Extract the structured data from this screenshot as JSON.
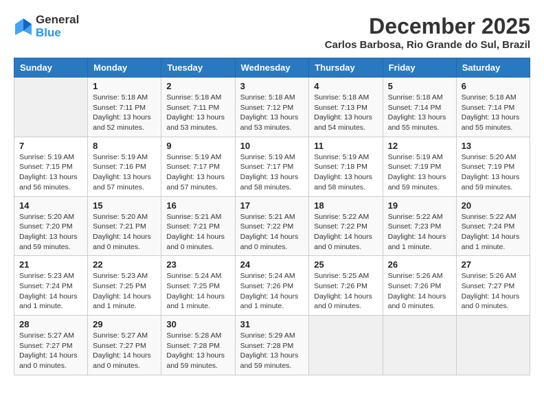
{
  "header": {
    "logo_line1": "General",
    "logo_line2": "Blue",
    "month_year": "December 2025",
    "location": "Carlos Barbosa, Rio Grande do Sul, Brazil"
  },
  "weekdays": [
    "Sunday",
    "Monday",
    "Tuesday",
    "Wednesday",
    "Thursday",
    "Friday",
    "Saturday"
  ],
  "weeks": [
    [
      {
        "day": "",
        "info": ""
      },
      {
        "day": "1",
        "info": "Sunrise: 5:18 AM\nSunset: 7:11 PM\nDaylight: 13 hours\nand 52 minutes."
      },
      {
        "day": "2",
        "info": "Sunrise: 5:18 AM\nSunset: 7:11 PM\nDaylight: 13 hours\nand 53 minutes."
      },
      {
        "day": "3",
        "info": "Sunrise: 5:18 AM\nSunset: 7:12 PM\nDaylight: 13 hours\nand 53 minutes."
      },
      {
        "day": "4",
        "info": "Sunrise: 5:18 AM\nSunset: 7:13 PM\nDaylight: 13 hours\nand 54 minutes."
      },
      {
        "day": "5",
        "info": "Sunrise: 5:18 AM\nSunset: 7:14 PM\nDaylight: 13 hours\nand 55 minutes."
      },
      {
        "day": "6",
        "info": "Sunrise: 5:18 AM\nSunset: 7:14 PM\nDaylight: 13 hours\nand 55 minutes."
      }
    ],
    [
      {
        "day": "7",
        "info": "Sunrise: 5:19 AM\nSunset: 7:15 PM\nDaylight: 13 hours\nand 56 minutes."
      },
      {
        "day": "8",
        "info": "Sunrise: 5:19 AM\nSunset: 7:16 PM\nDaylight: 13 hours\nand 57 minutes."
      },
      {
        "day": "9",
        "info": "Sunrise: 5:19 AM\nSunset: 7:17 PM\nDaylight: 13 hours\nand 57 minutes."
      },
      {
        "day": "10",
        "info": "Sunrise: 5:19 AM\nSunset: 7:17 PM\nDaylight: 13 hours\nand 58 minutes."
      },
      {
        "day": "11",
        "info": "Sunrise: 5:19 AM\nSunset: 7:18 PM\nDaylight: 13 hours\nand 58 minutes."
      },
      {
        "day": "12",
        "info": "Sunrise: 5:19 AM\nSunset: 7:19 PM\nDaylight: 13 hours\nand 59 minutes."
      },
      {
        "day": "13",
        "info": "Sunrise: 5:20 AM\nSunset: 7:19 PM\nDaylight: 13 hours\nand 59 minutes."
      }
    ],
    [
      {
        "day": "14",
        "info": "Sunrise: 5:20 AM\nSunset: 7:20 PM\nDaylight: 13 hours\nand 59 minutes."
      },
      {
        "day": "15",
        "info": "Sunrise: 5:20 AM\nSunset: 7:21 PM\nDaylight: 14 hours\nand 0 minutes."
      },
      {
        "day": "16",
        "info": "Sunrise: 5:21 AM\nSunset: 7:21 PM\nDaylight: 14 hours\nand 0 minutes."
      },
      {
        "day": "17",
        "info": "Sunrise: 5:21 AM\nSunset: 7:22 PM\nDaylight: 14 hours\nand 0 minutes."
      },
      {
        "day": "18",
        "info": "Sunrise: 5:22 AM\nSunset: 7:22 PM\nDaylight: 14 hours\nand 0 minutes."
      },
      {
        "day": "19",
        "info": "Sunrise: 5:22 AM\nSunset: 7:23 PM\nDaylight: 14 hours\nand 1 minute."
      },
      {
        "day": "20",
        "info": "Sunrise: 5:22 AM\nSunset: 7:24 PM\nDaylight: 14 hours\nand 1 minute."
      }
    ],
    [
      {
        "day": "21",
        "info": "Sunrise: 5:23 AM\nSunset: 7:24 PM\nDaylight: 14 hours\nand 1 minute."
      },
      {
        "day": "22",
        "info": "Sunrise: 5:23 AM\nSunset: 7:25 PM\nDaylight: 14 hours\nand 1 minute."
      },
      {
        "day": "23",
        "info": "Sunrise: 5:24 AM\nSunset: 7:25 PM\nDaylight: 14 hours\nand 1 minute."
      },
      {
        "day": "24",
        "info": "Sunrise: 5:24 AM\nSunset: 7:26 PM\nDaylight: 14 hours\nand 1 minute."
      },
      {
        "day": "25",
        "info": "Sunrise: 5:25 AM\nSunset: 7:26 PM\nDaylight: 14 hours\nand 0 minutes."
      },
      {
        "day": "26",
        "info": "Sunrise: 5:26 AM\nSunset: 7:26 PM\nDaylight: 14 hours\nand 0 minutes."
      },
      {
        "day": "27",
        "info": "Sunrise: 5:26 AM\nSunset: 7:27 PM\nDaylight: 14 hours\nand 0 minutes."
      }
    ],
    [
      {
        "day": "28",
        "info": "Sunrise: 5:27 AM\nSunset: 7:27 PM\nDaylight: 14 hours\nand 0 minutes."
      },
      {
        "day": "29",
        "info": "Sunrise: 5:27 AM\nSunset: 7:27 PM\nDaylight: 14 hours\nand 0 minutes."
      },
      {
        "day": "30",
        "info": "Sunrise: 5:28 AM\nSunset: 7:28 PM\nDaylight: 13 hours\nand 59 minutes."
      },
      {
        "day": "31",
        "info": "Sunrise: 5:29 AM\nSunset: 7:28 PM\nDaylight: 13 hours\nand 59 minutes."
      },
      {
        "day": "",
        "info": ""
      },
      {
        "day": "",
        "info": ""
      },
      {
        "day": "",
        "info": ""
      }
    ]
  ]
}
